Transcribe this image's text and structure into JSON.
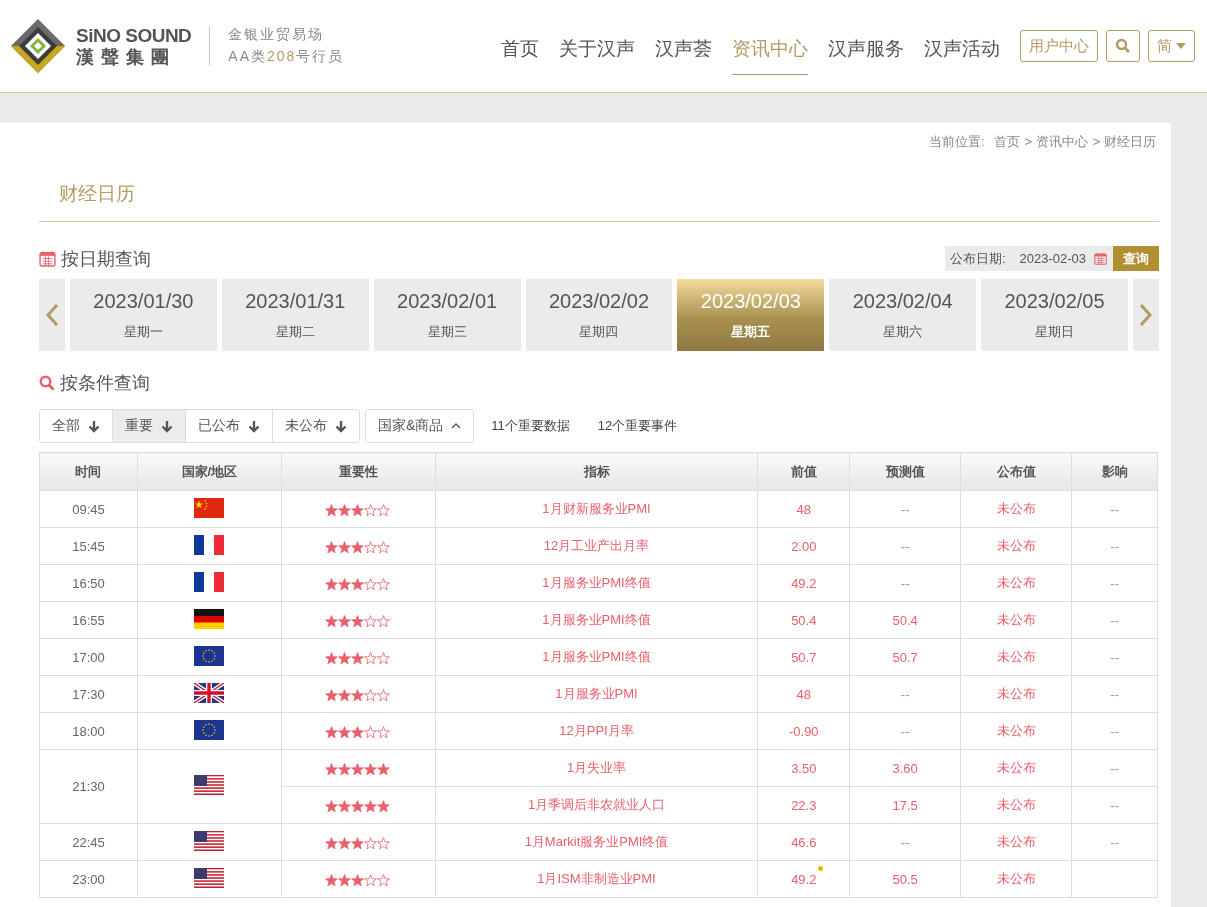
{
  "header": {
    "brand_en": "SiNO SOUND",
    "brand_cn": "漢 聲 集 團",
    "tagline_1": "金银业贸易场",
    "tagline_2_pre": "AA类",
    "tagline_2_num": "208",
    "tagline_2_post": "号行员",
    "nav": [
      {
        "label": "首页",
        "selected": false
      },
      {
        "label": "关于汉声",
        "selected": false
      },
      {
        "label": "汉声荟",
        "selected": false
      },
      {
        "label": "资讯中心",
        "selected": true
      },
      {
        "label": "汉声服务",
        "selected": false
      },
      {
        "label": "汉声活动",
        "selected": false
      }
    ],
    "user_button": "用户中心",
    "lang_button": "简"
  },
  "breadcrumb": {
    "prefix": "当前位置:",
    "items": [
      "首页",
      "> 资讯中心",
      "> 财经日历"
    ]
  },
  "page_title": "财经日历",
  "date_query": {
    "title": "按日期查询",
    "date_label": "公布日期:",
    "date_value": "2023-02-03",
    "button": "查询",
    "dates": [
      {
        "date": "2023/01/30",
        "weekday": "星期一",
        "selected": false
      },
      {
        "date": "2023/01/31",
        "weekday": "星期二",
        "selected": false
      },
      {
        "date": "2023/02/01",
        "weekday": "星期三",
        "selected": false
      },
      {
        "date": "2023/02/02",
        "weekday": "星期四",
        "selected": false
      },
      {
        "date": "2023/02/03",
        "weekday": "星期五",
        "selected": true
      },
      {
        "date": "2023/02/04",
        "weekday": "星期六",
        "selected": false
      },
      {
        "date": "2023/02/05",
        "weekday": "星期日",
        "selected": false
      }
    ]
  },
  "filter": {
    "title": "按条件查询",
    "options": [
      {
        "label": "全部",
        "selected": false
      },
      {
        "label": "重要",
        "selected": true
      },
      {
        "label": "已公布",
        "selected": false
      },
      {
        "label": "未公布",
        "selected": false
      }
    ],
    "country_button": "国家&商品",
    "count_data": "11个重要数据",
    "count_events": "12个重要事件"
  },
  "table": {
    "columns": [
      "时间",
      "国家/地区",
      "重要性",
      "指标",
      "前值",
      "预测值",
      "公布值",
      "影响"
    ],
    "groups": [
      {
        "time": "09:45",
        "kind": "cn",
        "rows": [
          {
            "stars": 3,
            "indicator": "1月财新服务业PMI",
            "previous": "48",
            "forecast": "--",
            "actual": "未公布",
            "impact": "--"
          }
        ]
      },
      {
        "time": "15:45",
        "kind": "fr",
        "rows": [
          {
            "stars": 3,
            "indicator": "12月工业产出月率",
            "previous": "2.00",
            "forecast": "--",
            "actual": "未公布",
            "impact": "--"
          }
        ]
      },
      {
        "time": "16:50",
        "kind": "fr",
        "rows": [
          {
            "stars": 3,
            "indicator": "1月服务业PMI终值",
            "previous": "49.2",
            "forecast": "--",
            "actual": "未公布",
            "impact": "--"
          }
        ]
      },
      {
        "time": "16:55",
        "kind": "de",
        "rows": [
          {
            "stars": 3,
            "indicator": "1月服务业PMI终值",
            "previous": "50.4",
            "forecast": "50.4",
            "actual": "未公布",
            "impact": "--"
          }
        ]
      },
      {
        "time": "17:00",
        "kind": "eu",
        "rows": [
          {
            "stars": 3,
            "indicator": "1月服务业PMI终值",
            "previous": "50.7",
            "forecast": "50.7",
            "actual": "未公布",
            "impact": "--"
          }
        ]
      },
      {
        "time": "17:30",
        "kind": "gb",
        "rows": [
          {
            "stars": 3,
            "indicator": "1月服务业PMI",
            "previous": "48",
            "forecast": "--",
            "actual": "未公布",
            "impact": "--"
          }
        ]
      },
      {
        "time": "18:00",
        "kind": "eu",
        "rows": [
          {
            "stars": 3,
            "indicator": "12月PPI月率",
            "previous": "-0.90",
            "forecast": "--",
            "actual": "未公布",
            "impact": "--"
          }
        ]
      },
      {
        "time": "21:30",
        "kind": "us",
        "rows": [
          {
            "stars": 5,
            "indicator": "1月失业率",
            "previous": "3.50",
            "forecast": "3.60",
            "actual": "未公布",
            "impact": "--"
          },
          {
            "stars": 5,
            "indicator": "1月季调后非农就业人口",
            "previous": "22.3",
            "forecast": "17.5",
            "actual": "未公布",
            "impact": "--"
          }
        ]
      },
      {
        "time": "22:45",
        "kind": "us",
        "rows": [
          {
            "stars": 3,
            "indicator": "1月Markit服务业PMI终值",
            "previous": "46.6",
            "forecast": "--",
            "actual": "未公布",
            "impact": "--"
          }
        ]
      },
      {
        "time": "23:00",
        "kind": "us",
        "rows": [
          {
            "stars": 3,
            "indicator": "1月ISM非制造业PMI",
            "previous": "49.2",
            "forecast": "50.5",
            "actual": "未公布",
            "marker": true
          }
        ]
      }
    ]
  }
}
